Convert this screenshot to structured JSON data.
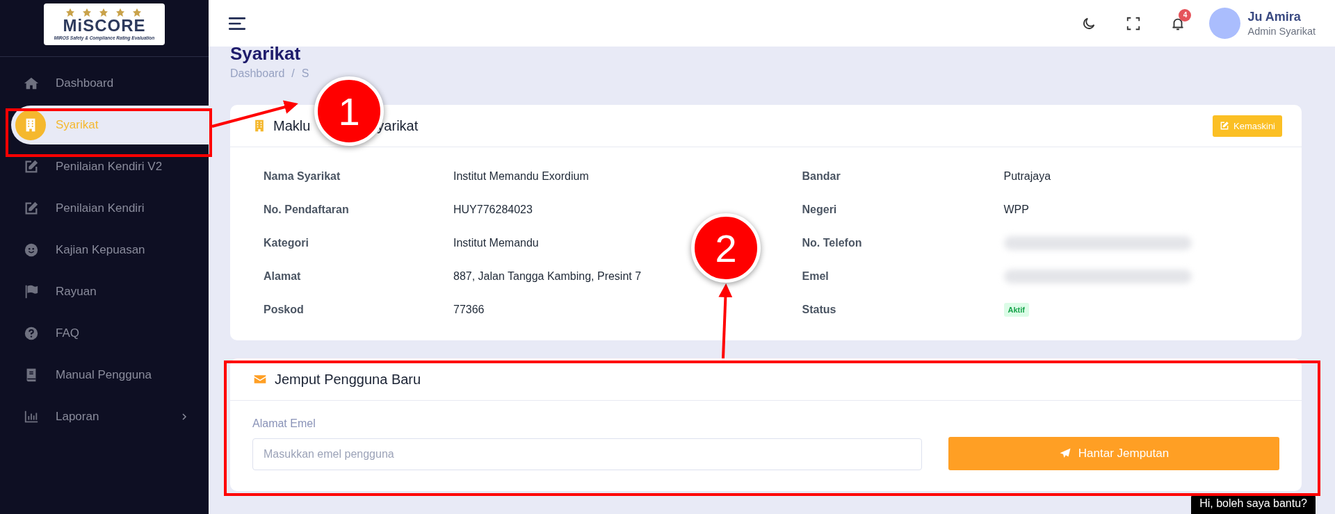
{
  "logo": {
    "title": "MiSCORE",
    "subtitle": "MIROS Safety & Compliance Rating Evaluation"
  },
  "sidebar": {
    "items": [
      {
        "label": "Dashboard",
        "selected": false,
        "has_submenu": false
      },
      {
        "label": "Syarikat",
        "selected": true,
        "has_submenu": false
      },
      {
        "label": "Penilaian Kendiri V2",
        "selected": false,
        "has_submenu": false
      },
      {
        "label": "Penilaian Kendiri",
        "selected": false,
        "has_submenu": false
      },
      {
        "label": "Kajian Kepuasan",
        "selected": false,
        "has_submenu": false
      },
      {
        "label": "Rayuan",
        "selected": false,
        "has_submenu": false
      },
      {
        "label": "FAQ",
        "selected": false,
        "has_submenu": false
      },
      {
        "label": "Manual Pengguna",
        "selected": false,
        "has_submenu": false
      },
      {
        "label": "Laporan",
        "selected": false,
        "has_submenu": true
      }
    ]
  },
  "header": {
    "notification_count": "4",
    "user_name": "Ju Amira",
    "user_role": "Admin Syarikat"
  },
  "page": {
    "title": "Syarikat",
    "breadcrumb": [
      "Dashboard",
      "S"
    ],
    "breadcrumb_separator": "/"
  },
  "info_card": {
    "title_parts": [
      "Maklu",
      "yarikat"
    ],
    "edit_button": "Kemaskini",
    "left": [
      {
        "label": "Nama Syarikat",
        "value": "Institut Memandu Exordium",
        "kind": "text"
      },
      {
        "label": "No. Pendaftaran",
        "value": "HUY776284023",
        "kind": "text"
      },
      {
        "label": "Kategori",
        "value": "Institut Memandu",
        "kind": "text"
      },
      {
        "label": "Alamat",
        "value": "887, Jalan Tangga Kambing, Presint 7",
        "kind": "text"
      },
      {
        "label": "Poskod",
        "value": "77366",
        "kind": "text"
      }
    ],
    "right": [
      {
        "label": "Bandar",
        "value": "Putrajaya",
        "kind": "text"
      },
      {
        "label": "Negeri",
        "value": "WPP",
        "kind": "text"
      },
      {
        "label": "No. Telefon",
        "kind": "redacted"
      },
      {
        "label": "Emel",
        "kind": "redacted"
      },
      {
        "label": "Status",
        "value": "Aktif",
        "kind": "badge"
      }
    ]
  },
  "invite_card": {
    "title": "Jemput Pengguna Baru",
    "field_label": "Alamat Emel",
    "placeholder": "Masukkan emel pengguna",
    "button": "Hantar Jemputan"
  },
  "chat_tooltip": "Hi, boleh saya bantu?",
  "annotations": [
    {
      "kind": "callout",
      "label": "1"
    },
    {
      "kind": "callout",
      "label": "2"
    }
  ]
}
